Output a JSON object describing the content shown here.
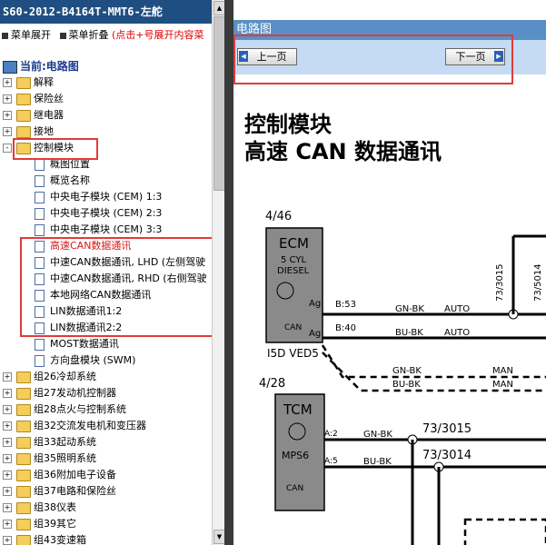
{
  "window": {
    "title": "S60-2012-B4164T-MMT6-左舵"
  },
  "menu": {
    "expand_label": "菜单展开",
    "collapse_label": "菜单折叠",
    "hint": "(点击+号展开内容菜"
  },
  "current": {
    "label": "当前:电路图"
  },
  "tree": {
    "top": [
      {
        "label": "解释",
        "pm": "+"
      },
      {
        "label": "保险丝",
        "pm": "+"
      },
      {
        "label": "继电器",
        "pm": "+"
      },
      {
        "label": "接地",
        "pm": "+"
      },
      {
        "label": "控制模块",
        "pm": "-"
      }
    ],
    "children": [
      {
        "label": "概图位置"
      },
      {
        "label": "概览名称"
      },
      {
        "label": "中央电子模块 (CEM) 1:3"
      },
      {
        "label": "中央电子模块 (CEM) 2:3"
      },
      {
        "label": "中央电子模块 (CEM) 3:3"
      },
      {
        "label": "高速CAN数据通讯",
        "selected": true
      },
      {
        "label": "中速CAN数据通讯, LHD (左侧驾驶"
      },
      {
        "label": "中速CAN数据通讯, RHD (右侧驾驶"
      },
      {
        "label": "本地网络CAN数据通讯"
      },
      {
        "label": "LIN数据通讯1:2"
      },
      {
        "label": "LIN数据通讯2:2"
      },
      {
        "label": "MOST数据通讯"
      },
      {
        "label": "方向盘模块 (SWM)"
      }
    ],
    "groups": [
      {
        "label": "组26冷却系统",
        "pm": "+"
      },
      {
        "label": "组27发动机控制器",
        "pm": "+"
      },
      {
        "label": "组28点火与控制系统",
        "pm": "+"
      },
      {
        "label": "组32交流发电机和变压器",
        "pm": "+"
      },
      {
        "label": "组33起动系统",
        "pm": "+"
      },
      {
        "label": "组35照明系统",
        "pm": "+"
      },
      {
        "label": "组36附加电子设备",
        "pm": "+"
      },
      {
        "label": "组37电路和保险丝",
        "pm": "+"
      },
      {
        "label": "组38仪表",
        "pm": "+"
      },
      {
        "label": "组39其它",
        "pm": "+"
      },
      {
        "label": "组43变速箱",
        "pm": "+"
      }
    ]
  },
  "right": {
    "header": "电路图",
    "prev_label": "上一页",
    "next_label": "下一页",
    "doc_title_1": "控制模块",
    "doc_title_2": "高速 CAN 数据通讯"
  },
  "diagram": {
    "ecm": {
      "ref": "4/46",
      "name": "ECM",
      "sub1": "5 CYL",
      "sub2": "DIESEL",
      "code": "I5D VED5",
      "ag": "Ag",
      "can": "CAN"
    },
    "tcm": {
      "ref": "4/28",
      "name": "TCM",
      "sub1": "MPS6",
      "can": "CAN"
    },
    "wires": {
      "b53": "B:53",
      "b40": "B:40",
      "gn_bk": "GN-BK",
      "bu_bk": "BU-BK",
      "auto": "AUTO",
      "man": "MAN",
      "a2": "A:2",
      "a5": "A:5",
      "c1": "73/3015",
      "c2": "73/3014",
      "c3": "73/5014"
    }
  },
  "colors": {
    "title_bg": "#1f4f82",
    "header_bg": "#5a8fc6",
    "nav_bg": "#c5dbf3",
    "highlight": "#e03b3b",
    "selected_text": "#d41a1a",
    "module_fill": "#8a8a8a"
  }
}
